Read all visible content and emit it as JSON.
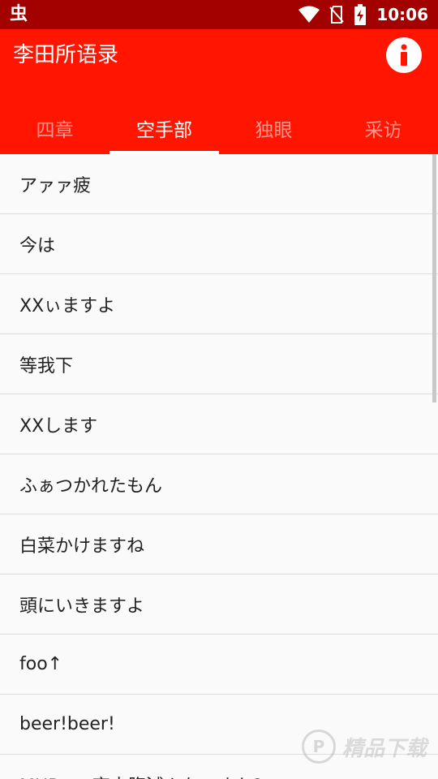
{
  "status_bar": {
    "app_icon_glyph": "虫",
    "time": "10:06",
    "icons": [
      "wifi-icon",
      "no-sim-icon",
      "battery-charging-icon"
    ],
    "color": "#a30000"
  },
  "app_bar": {
    "title": "李田所语录",
    "info_icon": "info-icon",
    "color": "#ff1500"
  },
  "tabs": [
    {
      "label": "四章",
      "active": false
    },
    {
      "label": "空手部",
      "active": true
    },
    {
      "label": "独眼",
      "active": false
    },
    {
      "label": "采访",
      "active": false
    }
  ],
  "list_items": [
    "アァァ疲",
    "今は",
    "XXぃますよ",
    "等我下",
    "XXします",
    "ふぁつかれたもん",
    "白菜かけますね",
    "頭にいきますよ",
    "foo↑",
    "beer!beer!",
    "MUR≠...夜中腹減んないすか?"
  ],
  "watermark": {
    "icon_glyph": "P",
    "text": "精品下载"
  }
}
